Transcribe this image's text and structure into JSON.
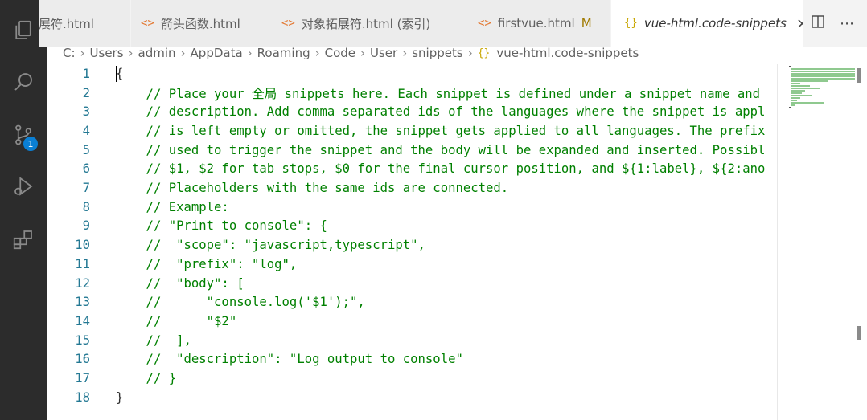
{
  "activity": {
    "items": [
      {
        "name": "explorer-icon"
      },
      {
        "name": "search-icon"
      },
      {
        "name": "source-control-icon",
        "badge": "1"
      },
      {
        "name": "run-debug-icon"
      },
      {
        "name": "extensions-icon"
      }
    ]
  },
  "tabs": [
    {
      "icon": "<>",
      "label": "展符.html",
      "active": false
    },
    {
      "icon": "<>",
      "label": "箭头函数.html",
      "active": false
    },
    {
      "icon": "<>",
      "label": "对象拓展符.html (索引)",
      "active": false
    },
    {
      "icon": "<>",
      "label": "firstvue.html",
      "modified": "M",
      "active": false
    },
    {
      "icon": "{}",
      "label": "vue-html.code-snippets",
      "close": "×",
      "active": true
    }
  ],
  "breadcrumb": [
    "C:",
    "Users",
    "admin",
    "AppData",
    "Roaming",
    "Code",
    "User",
    "snippets"
  ],
  "breadcrumb_file": {
    "icon": "{}",
    "label": "vue-html.code-snippets"
  },
  "editor": {
    "lines": [
      {
        "n": "1",
        "text": "{",
        "kind": "brace"
      },
      {
        "n": "2",
        "text": "    // Place your 全局 snippets here. Each snippet is defined under a snippet name and",
        "kind": "comment"
      },
      {
        "n": "3",
        "text": "    // description. Add comma separated ids of the languages where the snippet is appl",
        "kind": "comment"
      },
      {
        "n": "4",
        "text": "    // is left empty or omitted, the snippet gets applied to all languages. The prefix",
        "kind": "comment"
      },
      {
        "n": "5",
        "text": "    // used to trigger the snippet and the body will be expanded and inserted. Possibl",
        "kind": "comment"
      },
      {
        "n": "6",
        "text": "    // $1, $2 for tab stops, $0 for the final cursor position, and ${1:label}, ${2:ano",
        "kind": "comment"
      },
      {
        "n": "7",
        "text": "    // Placeholders with the same ids are connected.",
        "kind": "comment"
      },
      {
        "n": "8",
        "text": "    // Example:",
        "kind": "comment"
      },
      {
        "n": "9",
        "text": "    // \"Print to console\": {",
        "kind": "comment"
      },
      {
        "n": "10",
        "text": "    //  \"scope\": \"javascript,typescript\",",
        "kind": "comment"
      },
      {
        "n": "11",
        "text": "    //  \"prefix\": \"log\",",
        "kind": "comment"
      },
      {
        "n": "12",
        "text": "    //  \"body\": [",
        "kind": "comment"
      },
      {
        "n": "13",
        "text": "    //      \"console.log('$1');\",",
        "kind": "comment"
      },
      {
        "n": "14",
        "text": "    //      \"$2\"",
        "kind": "comment"
      },
      {
        "n": "15",
        "text": "    //  ],",
        "kind": "comment"
      },
      {
        "n": "16",
        "text": "    //  \"description\": \"Log output to console\"",
        "kind": "comment"
      },
      {
        "n": "17",
        "text": "    // }",
        "kind": "comment"
      },
      {
        "n": "18",
        "text": "}",
        "kind": "brace"
      }
    ]
  },
  "colors": {
    "comment": "#008000",
    "line_number": "#237893",
    "activity_bar": "#2c2c2c",
    "badge": "#0a7fd4"
  }
}
